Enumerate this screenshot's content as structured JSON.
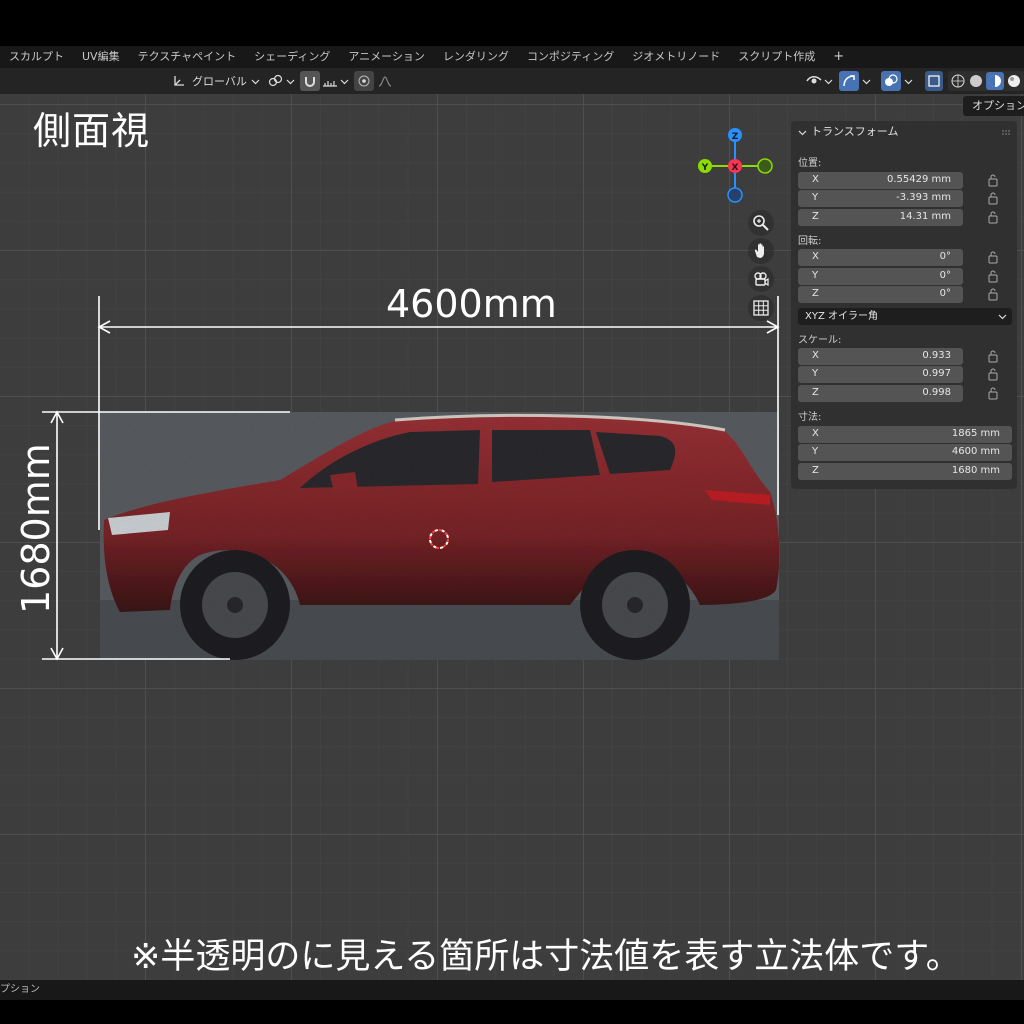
{
  "workspace_tabs": [
    "スカルプト",
    "UV編集",
    "テクスチャペイント",
    "シェーディング",
    "アニメーション",
    "レンダリング",
    "コンポジティング",
    "ジオメトリノード",
    "スクリプト作成"
  ],
  "add_tab_label": "+",
  "header": {
    "transform_orientation": "グローバル"
  },
  "overlay": {
    "view_title": "側面視",
    "width_dimension": "4600mm",
    "height_dimension": "1680mm",
    "note": "※半透明のに見える箇所は寸法値を表す立法体です。"
  },
  "options_button": "オプション",
  "transform_panel": {
    "title": "トランスフォーム",
    "location_label": "位置:",
    "location": [
      {
        "axis": "X",
        "value": "0.55429 mm"
      },
      {
        "axis": "Y",
        "value": "-3.393 mm"
      },
      {
        "axis": "Z",
        "value": "14.31 mm"
      }
    ],
    "rotation_label": "回転:",
    "rotation": [
      {
        "axis": "X",
        "value": "0°"
      },
      {
        "axis": "Y",
        "value": "0°"
      },
      {
        "axis": "Z",
        "value": "0°"
      }
    ],
    "rotation_mode": "XYZ オイラー角",
    "scale_label": "スケール:",
    "scale": [
      {
        "axis": "X",
        "value": "0.933"
      },
      {
        "axis": "Y",
        "value": "0.997"
      },
      {
        "axis": "Z",
        "value": "0.998"
      }
    ],
    "dimensions_label": "寸法:",
    "dimensions": [
      {
        "axis": "X",
        "value": "1865 mm"
      },
      {
        "axis": "Y",
        "value": "4600 mm"
      },
      {
        "axis": "Z",
        "value": "1680 mm"
      }
    ]
  },
  "gizmo": {
    "x_label": "X",
    "y_label": "Y",
    "z_label": "Z"
  },
  "status_bar": {
    "text": "オプション"
  },
  "colors": {
    "gizmo_x": "#ff3352",
    "gizmo_y": "#8bdc00",
    "gizmo_z": "#2890ff",
    "car_body": "#8a2a2c",
    "active_button": "#4772b3"
  }
}
